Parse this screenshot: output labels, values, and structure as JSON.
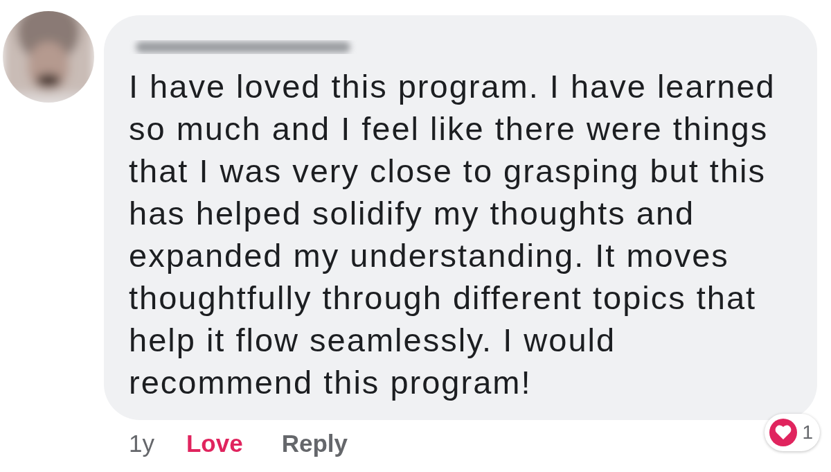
{
  "comment": {
    "text": "I have loved this program. I have learned so much and I feel like there were things that I was very close to grasping but this has helped solidify my thoughts and expanded my understanding. It moves thoughtfully through different topics that help it flow seamlessly. I would recommend this program!",
    "time": "1y",
    "love": {
      "label": "Love",
      "selected": true
    },
    "reply": "Reply",
    "reactions": {
      "count": "1"
    }
  }
}
